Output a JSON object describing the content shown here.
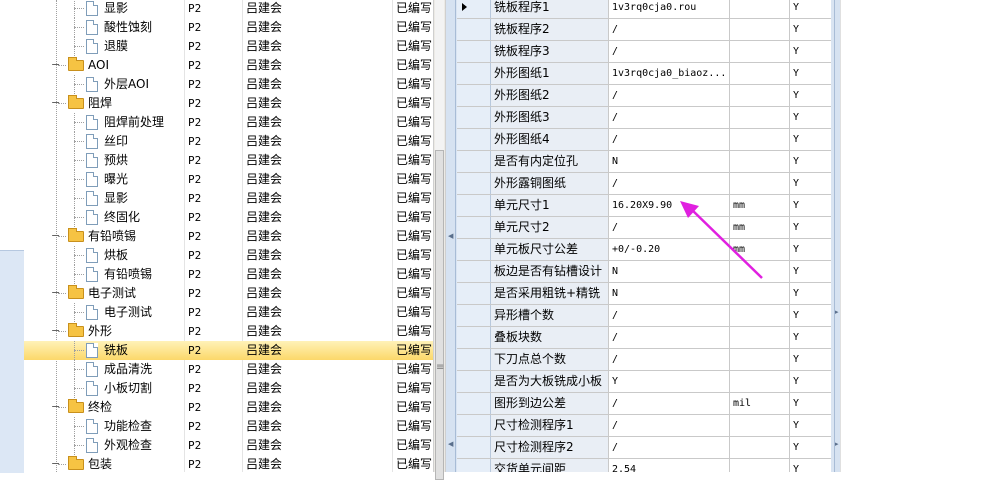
{
  "tree": {
    "rows": [
      {
        "label": "显影",
        "code": "P2",
        "person": "吕建会",
        "status": "已编写",
        "level": 2,
        "type": "doc"
      },
      {
        "label": "酸性蚀刻",
        "code": "P2",
        "person": "吕建会",
        "status": "已编写",
        "level": 2,
        "type": "doc"
      },
      {
        "label": "退膜",
        "code": "P2",
        "person": "吕建会",
        "status": "已编写",
        "level": 2,
        "type": "doc"
      },
      {
        "label": "AOI",
        "code": "P2",
        "person": "吕建会",
        "status": "已编写",
        "level": 1,
        "type": "folder"
      },
      {
        "label": "外层AOI",
        "code": "P2",
        "person": "吕建会",
        "status": "已编写",
        "level": 2,
        "type": "doc"
      },
      {
        "label": "阻焊",
        "code": "P2",
        "person": "吕建会",
        "status": "已编写",
        "level": 1,
        "type": "folder"
      },
      {
        "label": "阻焊前处理",
        "code": "P2",
        "person": "吕建会",
        "status": "已编写",
        "level": 2,
        "type": "doc"
      },
      {
        "label": "丝印",
        "code": "P2",
        "person": "吕建会",
        "status": "已编写",
        "level": 2,
        "type": "doc"
      },
      {
        "label": "预烘",
        "code": "P2",
        "person": "吕建会",
        "status": "已编写",
        "level": 2,
        "type": "doc"
      },
      {
        "label": "曝光",
        "code": "P2",
        "person": "吕建会",
        "status": "已编写",
        "level": 2,
        "type": "doc"
      },
      {
        "label": "显影",
        "code": "P2",
        "person": "吕建会",
        "status": "已编写",
        "level": 2,
        "type": "doc"
      },
      {
        "label": "终固化",
        "code": "P2",
        "person": "吕建会",
        "status": "已编写",
        "level": 2,
        "type": "doc"
      },
      {
        "label": "有铅喷锡",
        "code": "P2",
        "person": "吕建会",
        "status": "已编写",
        "level": 1,
        "type": "folder"
      },
      {
        "label": "烘板",
        "code": "P2",
        "person": "吕建会",
        "status": "已编写",
        "level": 2,
        "type": "doc"
      },
      {
        "label": "有铅喷锡",
        "code": "P2",
        "person": "吕建会",
        "status": "已编写",
        "level": 2,
        "type": "doc"
      },
      {
        "label": "电子测试",
        "code": "P2",
        "person": "吕建会",
        "status": "已编写",
        "level": 1,
        "type": "folder"
      },
      {
        "label": "电子测试",
        "code": "P2",
        "person": "吕建会",
        "status": "已编写",
        "level": 2,
        "type": "doc"
      },
      {
        "label": "外形",
        "code": "P2",
        "person": "吕建会",
        "status": "已编写",
        "level": 1,
        "type": "folder"
      },
      {
        "label": "铣板",
        "code": "P2",
        "person": "吕建会",
        "status": "已编写",
        "level": 2,
        "type": "doc",
        "selected": true
      },
      {
        "label": "成品清洗",
        "code": "P2",
        "person": "吕建会",
        "status": "已编写",
        "level": 2,
        "type": "doc"
      },
      {
        "label": "小板切割",
        "code": "P2",
        "person": "吕建会",
        "status": "已编写",
        "level": 2,
        "type": "doc"
      },
      {
        "label": "终检",
        "code": "P2",
        "person": "吕建会",
        "status": "已编写",
        "level": 1,
        "type": "folder"
      },
      {
        "label": "功能检查",
        "code": "P2",
        "person": "吕建会",
        "status": "已编写",
        "level": 2,
        "type": "doc"
      },
      {
        "label": "外观检查",
        "code": "P2",
        "person": "吕建会",
        "status": "已编写",
        "level": 2,
        "type": "doc"
      },
      {
        "label": "包装",
        "code": "P2",
        "person": "吕建会",
        "status": "已编写",
        "level": 1,
        "type": "folder"
      }
    ]
  },
  "properties": {
    "rows": [
      {
        "name": "铣板程序1",
        "value": "1v3rq0cja0.rou",
        "unit": "",
        "flag": "Y",
        "current": true
      },
      {
        "name": "铣板程序2",
        "value": "/",
        "unit": "",
        "flag": "Y"
      },
      {
        "name": "铣板程序3",
        "value": "/",
        "unit": "",
        "flag": "Y"
      },
      {
        "name": "外形图纸1",
        "value": "1v3rq0cja0_biaoz...",
        "unit": "",
        "flag": "Y"
      },
      {
        "name": "外形图纸2",
        "value": "/",
        "unit": "",
        "flag": "Y"
      },
      {
        "name": "外形图纸3",
        "value": "/",
        "unit": "",
        "flag": "Y"
      },
      {
        "name": "外形图纸4",
        "value": "/",
        "unit": "",
        "flag": "Y"
      },
      {
        "name": "是否有内定位孔",
        "value": "N",
        "unit": "",
        "flag": "Y"
      },
      {
        "name": "外形露铜图纸",
        "value": "/",
        "unit": "",
        "flag": "Y"
      },
      {
        "name": "单元尺寸1",
        "value": "16.20X9.90",
        "unit": "mm",
        "flag": "Y"
      },
      {
        "name": "单元尺寸2",
        "value": "/",
        "unit": "mm",
        "flag": "Y"
      },
      {
        "name": "单元板尺寸公差",
        "value": "+0/-0.20",
        "unit": "mm",
        "flag": "Y"
      },
      {
        "name": "板边是否有钻槽设计",
        "value": "N",
        "unit": "",
        "flag": "Y"
      },
      {
        "name": "是否采用粗铣+精铣",
        "value": "N",
        "unit": "",
        "flag": "Y"
      },
      {
        "name": "异形槽个数",
        "value": "/",
        "unit": "",
        "flag": "Y"
      },
      {
        "name": "叠板块数",
        "value": "/",
        "unit": "",
        "flag": "Y"
      },
      {
        "name": "下刀点总个数",
        "value": "/",
        "unit": "",
        "flag": "Y"
      },
      {
        "name": "是否为大板铣成小板",
        "value": "Y",
        "unit": "",
        "flag": "Y"
      },
      {
        "name": "图形到边公差",
        "value": "/",
        "unit": "mil",
        "flag": "Y"
      },
      {
        "name": "尺寸检测程序1",
        "value": "/",
        "unit": "",
        "flag": "Y"
      },
      {
        "name": "尺寸检测程序2",
        "value": "/",
        "unit": "",
        "flag": "Y"
      },
      {
        "name": "交货单元间距",
        "value": "2.54",
        "unit": "",
        "flag": "Y"
      }
    ]
  },
  "annotation": {
    "color": "#e020e0",
    "icon": "arrow-annotation-icon"
  },
  "colors": {
    "selected_row": "#fcd86a",
    "grid_line": "#c9c9c9",
    "panel_blue": "#d9e4f2"
  }
}
